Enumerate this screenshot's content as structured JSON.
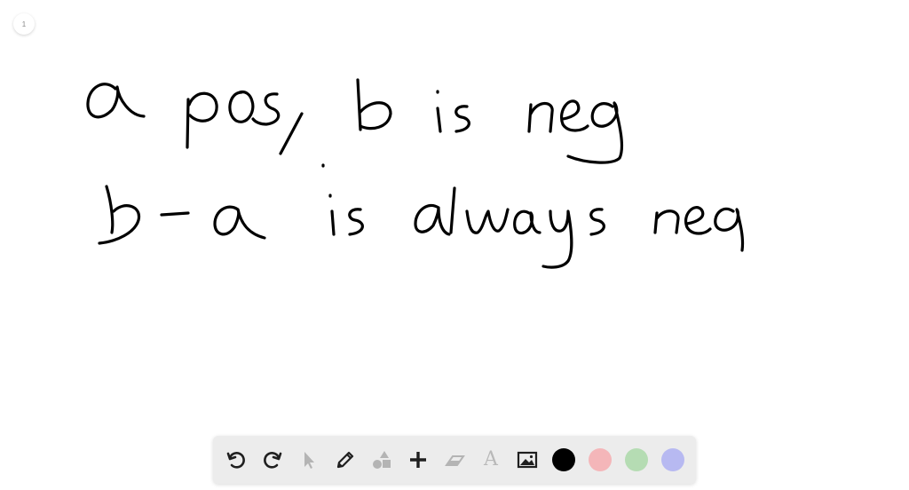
{
  "page": {
    "number": "1"
  },
  "handwriting": {
    "line1": "a pos, b is neg",
    "line2": "b - a is always neg"
  },
  "toolbar": {
    "tools": [
      {
        "name": "undo",
        "icon": "undo-icon",
        "enabled": true
      },
      {
        "name": "redo",
        "icon": "redo-icon",
        "enabled": true
      },
      {
        "name": "select",
        "icon": "pointer-icon",
        "enabled": false
      },
      {
        "name": "pen",
        "icon": "pencil-icon",
        "enabled": true
      },
      {
        "name": "shapes",
        "icon": "shapes-icon",
        "enabled": false
      },
      {
        "name": "add",
        "icon": "plus-icon",
        "enabled": true
      },
      {
        "name": "eraser",
        "icon": "eraser-icon",
        "enabled": false
      },
      {
        "name": "text",
        "icon": "text-icon",
        "label": "A",
        "enabled": false
      },
      {
        "name": "image",
        "icon": "image-icon",
        "enabled": true
      }
    ],
    "colors": [
      "#000000",
      "#f4b6b9",
      "#b5dcb3",
      "#b7b9f1"
    ]
  }
}
